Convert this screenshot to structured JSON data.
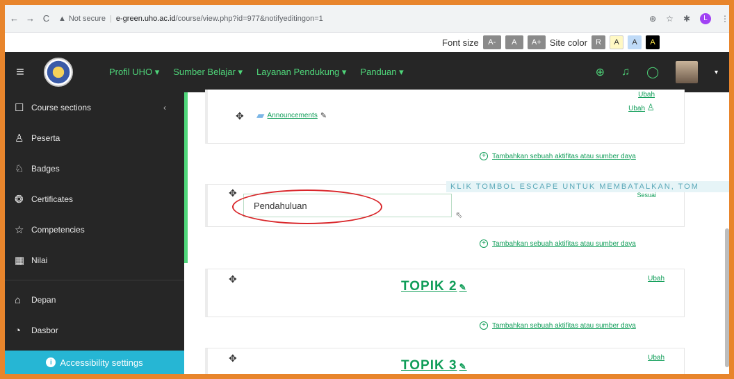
{
  "browser": {
    "back": "←",
    "forward": "→",
    "reload": "C",
    "security_label": "Not secure",
    "url_host": "e-green.uho.ac.id",
    "url_path": "/course/view.php?id=977&notifyeditingon=1",
    "profile_initial": "L"
  },
  "a11y_toolbar": {
    "font_size_label": "Font size",
    "font_buttons": [
      "A-",
      "A",
      "A+"
    ],
    "site_color_label": "Site color",
    "color_buttons": [
      "R",
      "A",
      "A",
      "A"
    ]
  },
  "navbar": {
    "menu_items": [
      "Profil UHO ▾",
      "Sumber Belajar ▾",
      "Layanan Pendukung ▾",
      "Panduan ▾"
    ]
  },
  "sidebar": {
    "items": [
      {
        "icon": "☐",
        "label": "Course sections"
      },
      {
        "icon": "♙",
        "label": "Peserta"
      },
      {
        "icon": "♘",
        "label": "Badges"
      },
      {
        "icon": "❂",
        "label": "Certificates"
      },
      {
        "icon": "☆",
        "label": "Competencies"
      },
      {
        "icon": "▦",
        "label": "Nilai"
      }
    ],
    "items2": [
      {
        "icon": "⌂",
        "label": "Depan"
      },
      {
        "icon": "◔",
        "label": "Dasbor"
      }
    ],
    "accessibility_label": "Accessibility settings"
  },
  "main": {
    "announcements": "Announcements",
    "ubah": "Ubah",
    "add_activity": "Tambahkan sebuah aktifitas atau sumber daya",
    "escape_hint": "KLIK TOMBOL ESCAPE UNTUK MEMBATALKAN, TOM",
    "section_input_value": "Pendahuluan",
    "hidden_link": "Sesuai",
    "topics": [
      "TOPIK 2",
      "TOPIK 3"
    ]
  }
}
